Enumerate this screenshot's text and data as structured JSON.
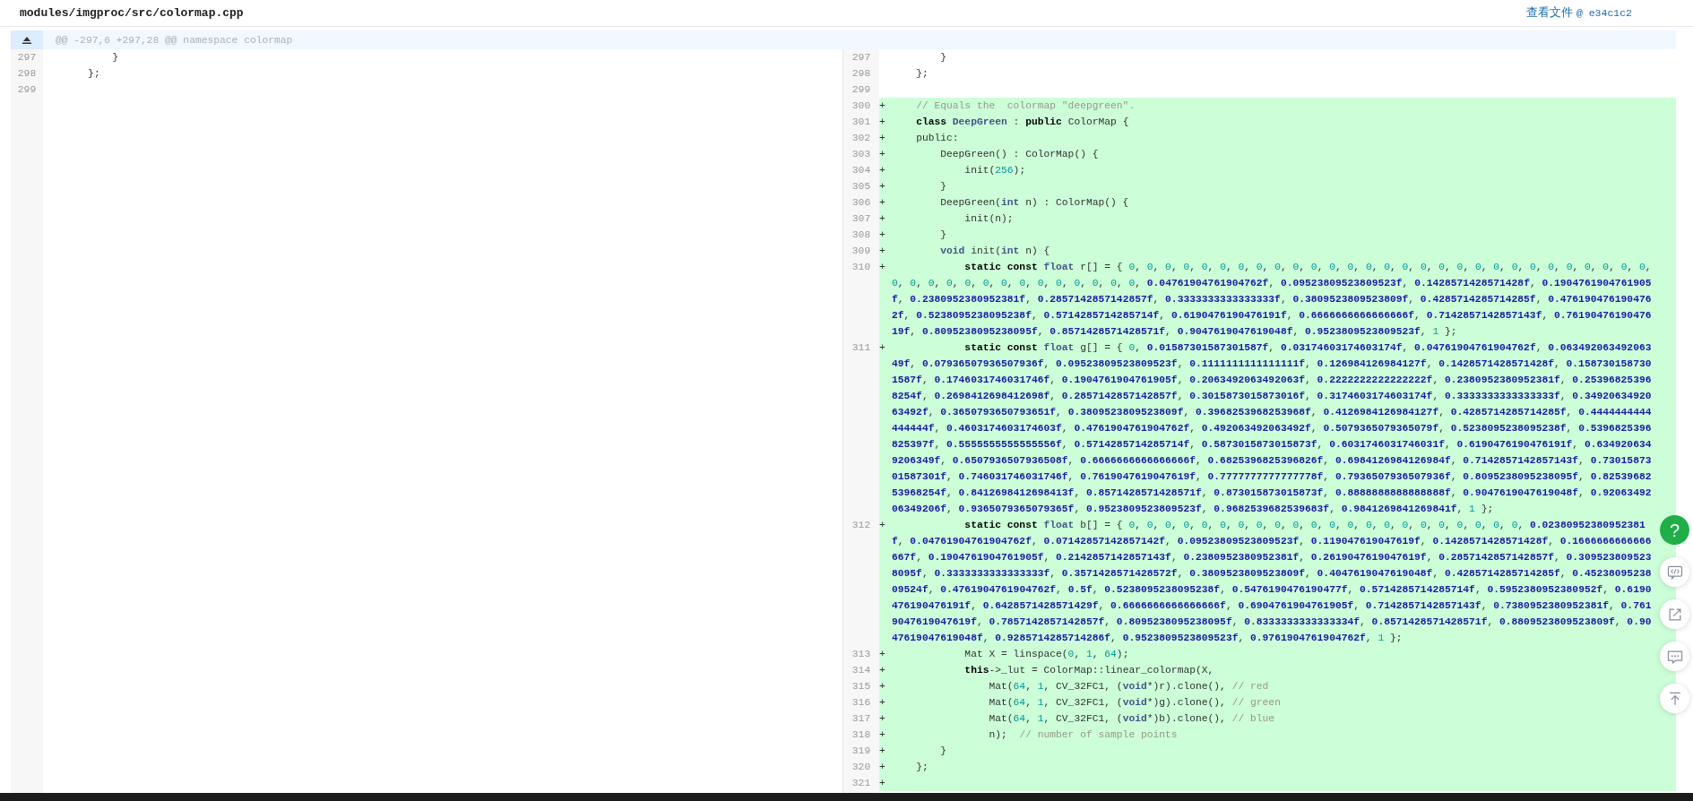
{
  "file": {
    "path": "modules/imgproc/src/colormap.cpp",
    "view_link": "查看文件",
    "commit": "@ e34c1c2"
  },
  "hunk_header": "@@ -297,6 +297,28 @@ namespace colormap",
  "left": {
    "lines": [
      {
        "number": "297",
        "code": [
          {
            "kind": "code",
            "text": "        }"
          }
        ]
      },
      {
        "number": "298",
        "code": [
          {
            "kind": "code",
            "text": "    };"
          }
        ]
      },
      {
        "number": "299"
      }
    ]
  },
  "right": {
    "lines": [
      {
        "number": "297",
        "added": false,
        "code": [
          {
            "kind": "code",
            "text": "        }"
          }
        ]
      },
      {
        "number": "298",
        "added": false,
        "code": [
          {
            "kind": "code",
            "text": "    };"
          }
        ]
      },
      {
        "number": "299",
        "added": false
      },
      {
        "number": "300",
        "added": true,
        "marker": "+",
        "code": [
          {
            "kind": "comment",
            "text": "    // Equals the  colormap \"deepgreen\"."
          }
        ]
      },
      {
        "number": "301",
        "added": true,
        "marker": "+",
        "code": [
          {
            "kind": "keyword",
            "text": "    class"
          },
          {
            "kind": "name",
            "text": " DeepGreen"
          },
          {
            "kind": "code",
            "text": " : "
          },
          {
            "kind": "keyword",
            "text": "public"
          },
          {
            "kind": "code",
            "text": " ColorMap {"
          }
        ]
      },
      {
        "number": "302",
        "added": true,
        "marker": "+",
        "code": [
          {
            "kind": "code",
            "text": "    public:"
          }
        ]
      },
      {
        "number": "303",
        "added": true,
        "marker": "+",
        "code": [
          {
            "kind": "code",
            "text": "        DeepGreen() : ColorMap() {"
          }
        ]
      },
      {
        "number": "304",
        "added": true,
        "marker": "+",
        "code": [
          {
            "kind": "code",
            "text": "            init(256);"
          }
        ]
      },
      {
        "number": "305",
        "added": true,
        "marker": "+",
        "code": [
          {
            "kind": "code",
            "text": "        }"
          }
        ]
      },
      {
        "number": "306",
        "added": true,
        "marker": "+",
        "code": [
          {
            "kind": "code",
            "text": "        DeepGreen("
          },
          {
            "kind": "type",
            "text": "int"
          },
          {
            "kind": "code",
            "text": " n) : ColorMap() {"
          }
        ]
      },
      {
        "number": "307",
        "added": true,
        "marker": "+",
        "code": [
          {
            "kind": "code",
            "text": "            init(n);"
          }
        ]
      },
      {
        "number": "308",
        "added": true,
        "marker": "+",
        "code": [
          {
            "kind": "code",
            "text": "        }"
          }
        ]
      },
      {
        "number": "309",
        "added": true,
        "marker": "+",
        "code": [
          {
            "kind": "type",
            "text": "        void"
          },
          {
            "kind": "code",
            "text": " init("
          },
          {
            "kind": "type",
            "text": "int"
          },
          {
            "kind": "code",
            "text": " n) {"
          }
        ]
      },
      {
        "number": "310",
        "added": true,
        "marker": "+",
        "code": [
          {
            "kind": "keyword",
            "text": "            static const"
          },
          {
            "kind": "type",
            "text": " float"
          },
          {
            "kind": "code",
            "text": " r[] = { 0, 0, 0, 0, 0, 0, 0, 0, 0, 0, 0, 0, 0, 0, 0, 0, 0, 0, 0, 0, 0, 0, 0, 0, 0, 0, 0, 0, 0, 0, 0, 0, 0, 0, 0, 0, 0, 0, 0, 0, 0, 0, 0, 0.04761904761904762f, 0.09523809523809523f, 0.1428571428571428f, 0.1904761904761905f, 0.2380952380952381f, 0.2857142857142857f, 0.3333333333333333f, 0.3809523809523809f, 0.4285714285714285f, 0.4761904761904762f, 0.5238095238095238f, 0.5714285714285714f, 0.6190476190476191f, 0.6666666666666666f, 0.7142857142857143f, 0.7619047619047619f, 0.8095238095238095f, 0.8571428571428571f, 0.9047619047619048f, 0.9523809523809523f, 1 };"
          }
        ]
      },
      {
        "number": "311",
        "added": true,
        "marker": "+",
        "code": [
          {
            "kind": "keyword",
            "text": "            static const"
          },
          {
            "kind": "type",
            "text": " float"
          },
          {
            "kind": "code",
            "text": " g[] = { 0, 0.01587301587301587f, 0.03174603174603174f, 0.04761904761904762f, 0.06349206349206349f, 0.07936507936507936f, 0.09523809523809523f, 0.1111111111111111f, 0.126984126984127f, 0.1428571428571428f, 0.1587301587301587f, 0.1746031746031746f, 0.1904761904761905f, 0.2063492063492063f, 0.2222222222222222f, 0.2380952380952381f, 0.253968253968254f, 0.2698412698412698f, 0.2857142857142857f, 0.3015873015873016f, 0.3174603174603174f, 0.3333333333333333f, 0.3492063492063492f, 0.3650793650793651f, 0.3809523809523809f, 0.3968253968253968f, 0.4126984126984127f, 0.4285714285714285f, 0.4444444444444444f, 0.4603174603174603f, 0.4761904761904762f, 0.492063492063492f, 0.5079365079365079f, 0.5238095238095238f, 0.5396825396825397f, 0.5555555555555556f, 0.5714285714285714f, 0.5873015873015873f, 0.6031746031746031f, 0.6190476190476191f, 0.6349206349206349f, 0.6507936507936508f, 0.6666666666666666f, 0.6825396825396826f, 0.6984126984126984f, 0.7142857142857143f, 0.7301587301587301f, 0.746031746031746f, 0.7619047619047619f, 0.7777777777777778f, 0.7936507936507936f, 0.8095238095238095f, 0.8253968253968254f, 0.8412698412698413f, 0.8571428571428571f, 0.873015873015873f, 0.8888888888888888f, 0.9047619047619048f, 0.9206349206349206f, 0.9365079365079365f, 0.9523809523809523f, 0.9682539682539683f, 0.9841269841269841f, 1 };"
          }
        ]
      },
      {
        "number": "312",
        "added": true,
        "marker": "+",
        "code": [
          {
            "kind": "keyword",
            "text": "            static const"
          },
          {
            "kind": "type",
            "text": " float"
          },
          {
            "kind": "code",
            "text": " b[] = { 0, 0, 0, 0, 0, 0, 0, 0, 0, 0, 0, 0, 0, 0, 0, 0, 0, 0, 0, 0, 0, 0, 0.02380952380952381f, 0.04761904761904762f, 0.07142857142857142f, 0.09523809523809523f, 0.119047619047619f, 0.1428571428571428f, 0.1666666666666667f, 0.1904761904761905f, 0.2142857142857143f, 0.2380952380952381f, 0.2619047619047619f, 0.2857142857142857f, 0.3095238095238095f, 0.3333333333333333f, 0.3571428571428572f, 0.3809523809523809f, 0.4047619047619048f, 0.4285714285714285f, 0.4523809523809524f, 0.4761904761904762f, 0.5f, 0.5238095238095238f, 0.5476190476190477f, 0.5714285714285714f, 0.5952380952380952f, 0.6190476190476191f, 0.6428571428571429f, 0.6666666666666666f, 0.6904761904761905f, 0.7142857142857143f, 0.7380952380952381f, 0.7619047619047619f, 0.7857142857142857f, 0.8095238095238095f, 0.8333333333333334f, 0.8571428571428571f, 0.8809523809523809f, 0.9047619047619048f, 0.9285714285714286f, 0.9523809523809523f, 0.9761904761904762f, 1 };"
          }
        ]
      },
      {
        "number": "313",
        "added": true,
        "marker": "+",
        "code": [
          {
            "kind": "code",
            "text": "            Mat X = linspace(0, 1, 64);"
          }
        ]
      },
      {
        "number": "314",
        "added": true,
        "marker": "+",
        "code": [
          {
            "kind": "keyword",
            "text": "            this"
          },
          {
            "kind": "code",
            "text": "->_lut = ColorMap::linear_colormap(X,"
          }
        ]
      },
      {
        "number": "315",
        "added": true,
        "marker": "+",
        "code": [
          {
            "kind": "code",
            "text": "                Mat(64, 1, CV_32FC1, ("
          },
          {
            "kind": "type",
            "text": "void"
          },
          {
            "kind": "code",
            "text": "*)r).clone(), "
          },
          {
            "kind": "comment",
            "text": "// red"
          }
        ]
      },
      {
        "number": "316",
        "added": true,
        "marker": "+",
        "code": [
          {
            "kind": "code",
            "text": "                Mat(64, 1, CV_32FC1, ("
          },
          {
            "kind": "type",
            "text": "void"
          },
          {
            "kind": "code",
            "text": "*)g).clone(), "
          },
          {
            "kind": "comment",
            "text": "// green"
          }
        ]
      },
      {
        "number": "317",
        "added": true,
        "marker": "+",
        "code": [
          {
            "kind": "code",
            "text": "                Mat(64, 1, CV_32FC1, ("
          },
          {
            "kind": "type",
            "text": "void"
          },
          {
            "kind": "code",
            "text": "*)b).clone(), "
          },
          {
            "kind": "comment",
            "text": "// blue"
          }
        ]
      },
      {
        "number": "318",
        "added": true,
        "marker": "+",
        "code": [
          {
            "kind": "code",
            "text": "                n);  "
          },
          {
            "kind": "comment",
            "text": "// number of sample points"
          }
        ]
      },
      {
        "number": "319",
        "added": true,
        "marker": "+",
        "code": [
          {
            "kind": "code",
            "text": "        }"
          }
        ]
      },
      {
        "number": "320",
        "added": true,
        "marker": "+",
        "code": [
          {
            "kind": "code",
            "text": "    };"
          }
        ]
      },
      {
        "number": "321",
        "added": true,
        "marker": "+"
      }
    ]
  },
  "floating_buttons": [
    {
      "kind": "help",
      "label": "?"
    },
    {
      "kind": "code"
    },
    {
      "kind": "share"
    },
    {
      "kind": "comment"
    },
    {
      "kind": "top"
    }
  ]
}
